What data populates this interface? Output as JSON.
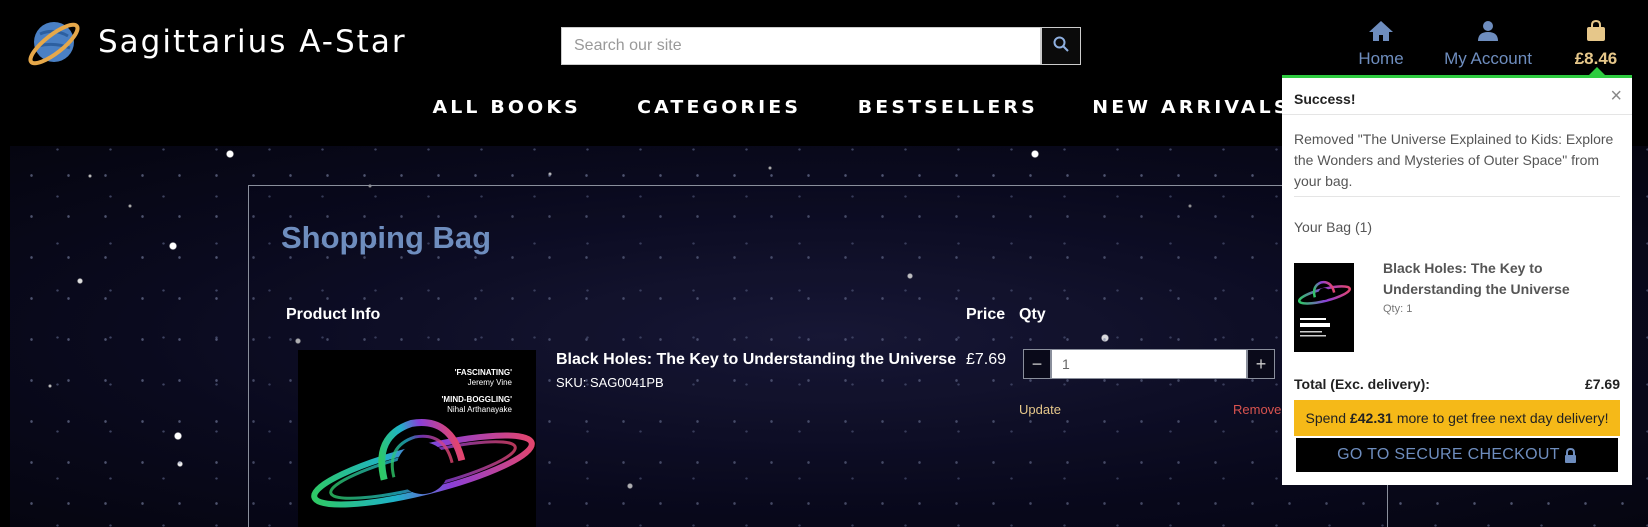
{
  "brand": {
    "name": "Sagittarius A-Star"
  },
  "search": {
    "placeholder": "Search our site"
  },
  "header_nav": {
    "home": "Home",
    "account": "My Account",
    "bag_total": "£8.46"
  },
  "main_nav": [
    "ALL BOOKS",
    "CATEGORIES",
    "BESTSELLERS",
    "NEW ARRIVALS"
  ],
  "cart_page": {
    "title": "Shopping Bag",
    "columns": {
      "product": "Product Info",
      "price": "Price",
      "qty": "Qty"
    },
    "item": {
      "title": "Black Holes: The Key to Understanding the Universe",
      "sku": "SKU: SAG0041PB",
      "price": "£7.69",
      "qty_value": "1",
      "quote1": "'FASCINATING'",
      "quote1_by": "Jeremy Vine",
      "quote2": "'MIND-BOGGLING'",
      "quote2_by": "Nihal Arthanayake"
    },
    "update_label": "Update",
    "remove_label": "Remove"
  },
  "dropdown": {
    "success": "Success!",
    "close": "×",
    "message": "Removed \"The Universe Explained to Kids: Explore the Wonders and Mysteries of Outer Space\" from your bag.",
    "bag_count": "Your Bag (1)",
    "item_title": "Black Holes: The Key to Understanding the Universe",
    "item_qty": "Qty: 1",
    "total_label": "Total (Exc. delivery):",
    "total_value": "£7.69",
    "promo_pre": "Spend",
    "promo_amount": "£42.31",
    "promo_post": "more to get free next day delivery!",
    "checkout": "GO TO SECURE CHECKOUT"
  },
  "colors": {
    "accent_blue": "#6e8dbe",
    "gold": "#e6c78a",
    "success_green": "#2ecc40",
    "promo_yellow": "#f5b918",
    "remove_red": "#d9534f"
  }
}
